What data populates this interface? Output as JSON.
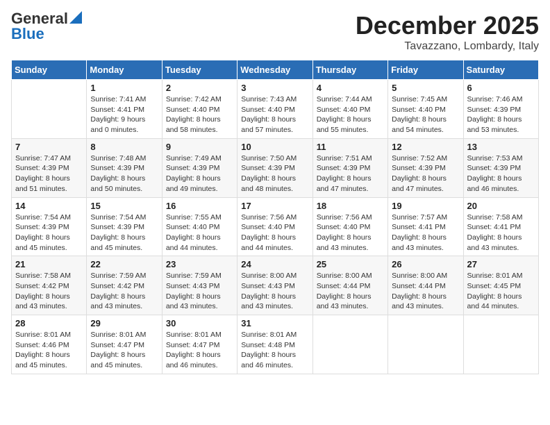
{
  "logo": {
    "general": "General",
    "blue": "Blue"
  },
  "title": "December 2025",
  "location": "Tavazzano, Lombardy, Italy",
  "weekdays": [
    "Sunday",
    "Monday",
    "Tuesday",
    "Wednesday",
    "Thursday",
    "Friday",
    "Saturday"
  ],
  "weeks": [
    [
      {
        "day": "",
        "sunrise": "",
        "sunset": "",
        "daylight": ""
      },
      {
        "day": "1",
        "sunrise": "Sunrise: 7:41 AM",
        "sunset": "Sunset: 4:41 PM",
        "daylight": "Daylight: 9 hours and 0 minutes."
      },
      {
        "day": "2",
        "sunrise": "Sunrise: 7:42 AM",
        "sunset": "Sunset: 4:40 PM",
        "daylight": "Daylight: 8 hours and 58 minutes."
      },
      {
        "day": "3",
        "sunrise": "Sunrise: 7:43 AM",
        "sunset": "Sunset: 4:40 PM",
        "daylight": "Daylight: 8 hours and 57 minutes."
      },
      {
        "day": "4",
        "sunrise": "Sunrise: 7:44 AM",
        "sunset": "Sunset: 4:40 PM",
        "daylight": "Daylight: 8 hours and 55 minutes."
      },
      {
        "day": "5",
        "sunrise": "Sunrise: 7:45 AM",
        "sunset": "Sunset: 4:40 PM",
        "daylight": "Daylight: 8 hours and 54 minutes."
      },
      {
        "day": "6",
        "sunrise": "Sunrise: 7:46 AM",
        "sunset": "Sunset: 4:39 PM",
        "daylight": "Daylight: 8 hours and 53 minutes."
      }
    ],
    [
      {
        "day": "7",
        "sunrise": "Sunrise: 7:47 AM",
        "sunset": "Sunset: 4:39 PM",
        "daylight": "Daylight: 8 hours and 51 minutes."
      },
      {
        "day": "8",
        "sunrise": "Sunrise: 7:48 AM",
        "sunset": "Sunset: 4:39 PM",
        "daylight": "Daylight: 8 hours and 50 minutes."
      },
      {
        "day": "9",
        "sunrise": "Sunrise: 7:49 AM",
        "sunset": "Sunset: 4:39 PM",
        "daylight": "Daylight: 8 hours and 49 minutes."
      },
      {
        "day": "10",
        "sunrise": "Sunrise: 7:50 AM",
        "sunset": "Sunset: 4:39 PM",
        "daylight": "Daylight: 8 hours and 48 minutes."
      },
      {
        "day": "11",
        "sunrise": "Sunrise: 7:51 AM",
        "sunset": "Sunset: 4:39 PM",
        "daylight": "Daylight: 8 hours and 47 minutes."
      },
      {
        "day": "12",
        "sunrise": "Sunrise: 7:52 AM",
        "sunset": "Sunset: 4:39 PM",
        "daylight": "Daylight: 8 hours and 47 minutes."
      },
      {
        "day": "13",
        "sunrise": "Sunrise: 7:53 AM",
        "sunset": "Sunset: 4:39 PM",
        "daylight": "Daylight: 8 hours and 46 minutes."
      }
    ],
    [
      {
        "day": "14",
        "sunrise": "Sunrise: 7:54 AM",
        "sunset": "Sunset: 4:39 PM",
        "daylight": "Daylight: 8 hours and 45 minutes."
      },
      {
        "day": "15",
        "sunrise": "Sunrise: 7:54 AM",
        "sunset": "Sunset: 4:39 PM",
        "daylight": "Daylight: 8 hours and 45 minutes."
      },
      {
        "day": "16",
        "sunrise": "Sunrise: 7:55 AM",
        "sunset": "Sunset: 4:40 PM",
        "daylight": "Daylight: 8 hours and 44 minutes."
      },
      {
        "day": "17",
        "sunrise": "Sunrise: 7:56 AM",
        "sunset": "Sunset: 4:40 PM",
        "daylight": "Daylight: 8 hours and 44 minutes."
      },
      {
        "day": "18",
        "sunrise": "Sunrise: 7:56 AM",
        "sunset": "Sunset: 4:40 PM",
        "daylight": "Daylight: 8 hours and 43 minutes."
      },
      {
        "day": "19",
        "sunrise": "Sunrise: 7:57 AM",
        "sunset": "Sunset: 4:41 PM",
        "daylight": "Daylight: 8 hours and 43 minutes."
      },
      {
        "day": "20",
        "sunrise": "Sunrise: 7:58 AM",
        "sunset": "Sunset: 4:41 PM",
        "daylight": "Daylight: 8 hours and 43 minutes."
      }
    ],
    [
      {
        "day": "21",
        "sunrise": "Sunrise: 7:58 AM",
        "sunset": "Sunset: 4:42 PM",
        "daylight": "Daylight: 8 hours and 43 minutes."
      },
      {
        "day": "22",
        "sunrise": "Sunrise: 7:59 AM",
        "sunset": "Sunset: 4:42 PM",
        "daylight": "Daylight: 8 hours and 43 minutes."
      },
      {
        "day": "23",
        "sunrise": "Sunrise: 7:59 AM",
        "sunset": "Sunset: 4:43 PM",
        "daylight": "Daylight: 8 hours and 43 minutes."
      },
      {
        "day": "24",
        "sunrise": "Sunrise: 8:00 AM",
        "sunset": "Sunset: 4:43 PM",
        "daylight": "Daylight: 8 hours and 43 minutes."
      },
      {
        "day": "25",
        "sunrise": "Sunrise: 8:00 AM",
        "sunset": "Sunset: 4:44 PM",
        "daylight": "Daylight: 8 hours and 43 minutes."
      },
      {
        "day": "26",
        "sunrise": "Sunrise: 8:00 AM",
        "sunset": "Sunset: 4:44 PM",
        "daylight": "Daylight: 8 hours and 43 minutes."
      },
      {
        "day": "27",
        "sunrise": "Sunrise: 8:01 AM",
        "sunset": "Sunset: 4:45 PM",
        "daylight": "Daylight: 8 hours and 44 minutes."
      }
    ],
    [
      {
        "day": "28",
        "sunrise": "Sunrise: 8:01 AM",
        "sunset": "Sunset: 4:46 PM",
        "daylight": "Daylight: 8 hours and 45 minutes."
      },
      {
        "day": "29",
        "sunrise": "Sunrise: 8:01 AM",
        "sunset": "Sunset: 4:47 PM",
        "daylight": "Daylight: 8 hours and 45 minutes."
      },
      {
        "day": "30",
        "sunrise": "Sunrise: 8:01 AM",
        "sunset": "Sunset: 4:47 PM",
        "daylight": "Daylight: 8 hours and 46 minutes."
      },
      {
        "day": "31",
        "sunrise": "Sunrise: 8:01 AM",
        "sunset": "Sunset: 4:48 PM",
        "daylight": "Daylight: 8 hours and 46 minutes."
      },
      {
        "day": "",
        "sunrise": "",
        "sunset": "",
        "daylight": ""
      },
      {
        "day": "",
        "sunrise": "",
        "sunset": "",
        "daylight": ""
      },
      {
        "day": "",
        "sunrise": "",
        "sunset": "",
        "daylight": ""
      }
    ]
  ]
}
